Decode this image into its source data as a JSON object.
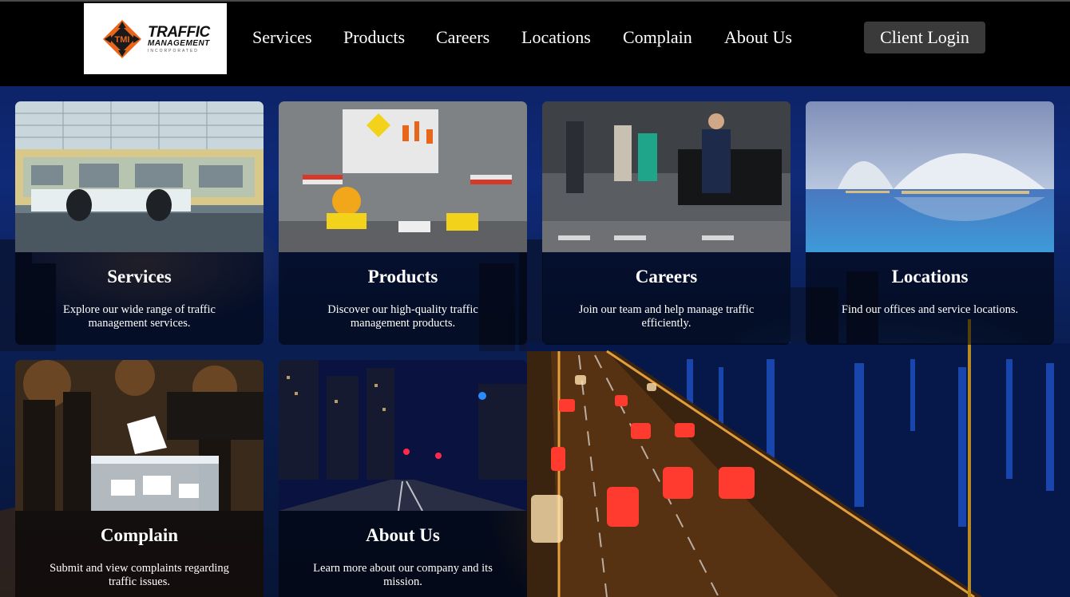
{
  "header": {
    "logo": {
      "mark_text": "TMI",
      "line1": "TRAFFIC",
      "line2": "MANAGEMENT",
      "line3": "INCORPORATED"
    },
    "nav": [
      "Services",
      "Products",
      "Careers",
      "Locations",
      "Complain",
      "About Us"
    ],
    "login_label": "Client Login"
  },
  "cards": [
    {
      "title": "Services",
      "description": "Explore our wide range of traffic management services."
    },
    {
      "title": "Products",
      "description": "Discover our high-quality traffic management products."
    },
    {
      "title": "Careers",
      "description": "Join our team and help manage traffic efficiently."
    },
    {
      "title": "Locations",
      "description": "Find our offices and service locations."
    },
    {
      "title": "Complain",
      "description": "Submit and view complaints regarding traffic issues."
    },
    {
      "title": "About Us",
      "description": "Learn more about our company and its mission."
    }
  ],
  "colors": {
    "header_bg": "#000000",
    "logo_orange": "#e8661c",
    "login_bg": "#3a3a3a",
    "text": "#ffffff"
  }
}
